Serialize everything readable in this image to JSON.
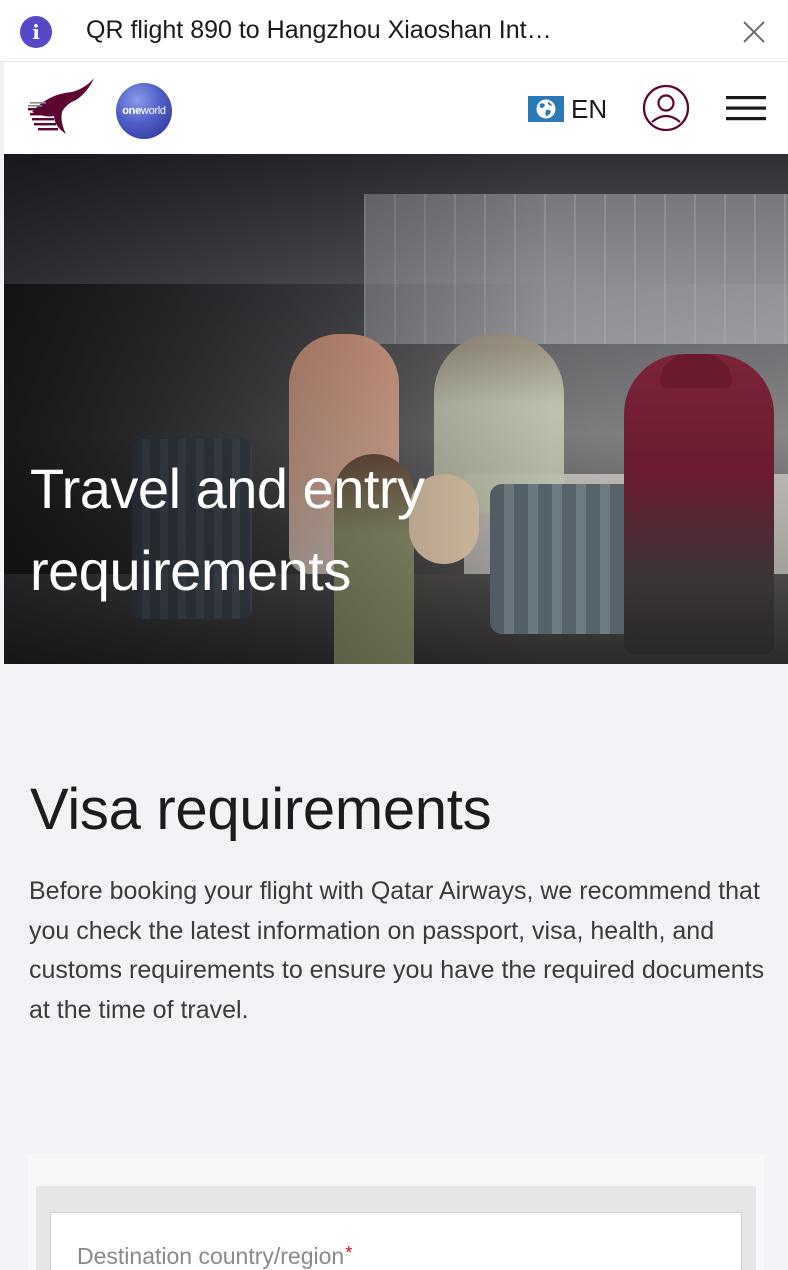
{
  "notification": {
    "text": "QR flight 890 to Hangzhou Xiaoshan Int…",
    "info_icon": "info-icon",
    "close_icon": "close-icon"
  },
  "header": {
    "logo": "qatar-airways-oryx-logo",
    "alliance_badge": {
      "text_bold": "one",
      "text_light": "world"
    },
    "language": {
      "flag_icon": "globe-flag-icon",
      "label": "EN"
    },
    "account_icon": "user-account-icon",
    "menu_icon": "hamburger-menu-icon"
  },
  "hero": {
    "title": "Travel and entry requirements"
  },
  "main": {
    "heading": "Visa requirements",
    "description": "Before booking your flight with Qatar Airways, we recommend that you check the latest information on passport, visa, health, and customs requirements to ensure you have the required documents at the time of travel.",
    "destination_field": {
      "placeholder": "Destination country/region",
      "required_marker": "*"
    }
  },
  "colors": {
    "brand_burgundy": "#5c0632",
    "info_purple": "#5648c7",
    "oneworld_blue": "#3a45b0",
    "required_red": "#b0102a",
    "page_bg": "#f2f3f7"
  }
}
